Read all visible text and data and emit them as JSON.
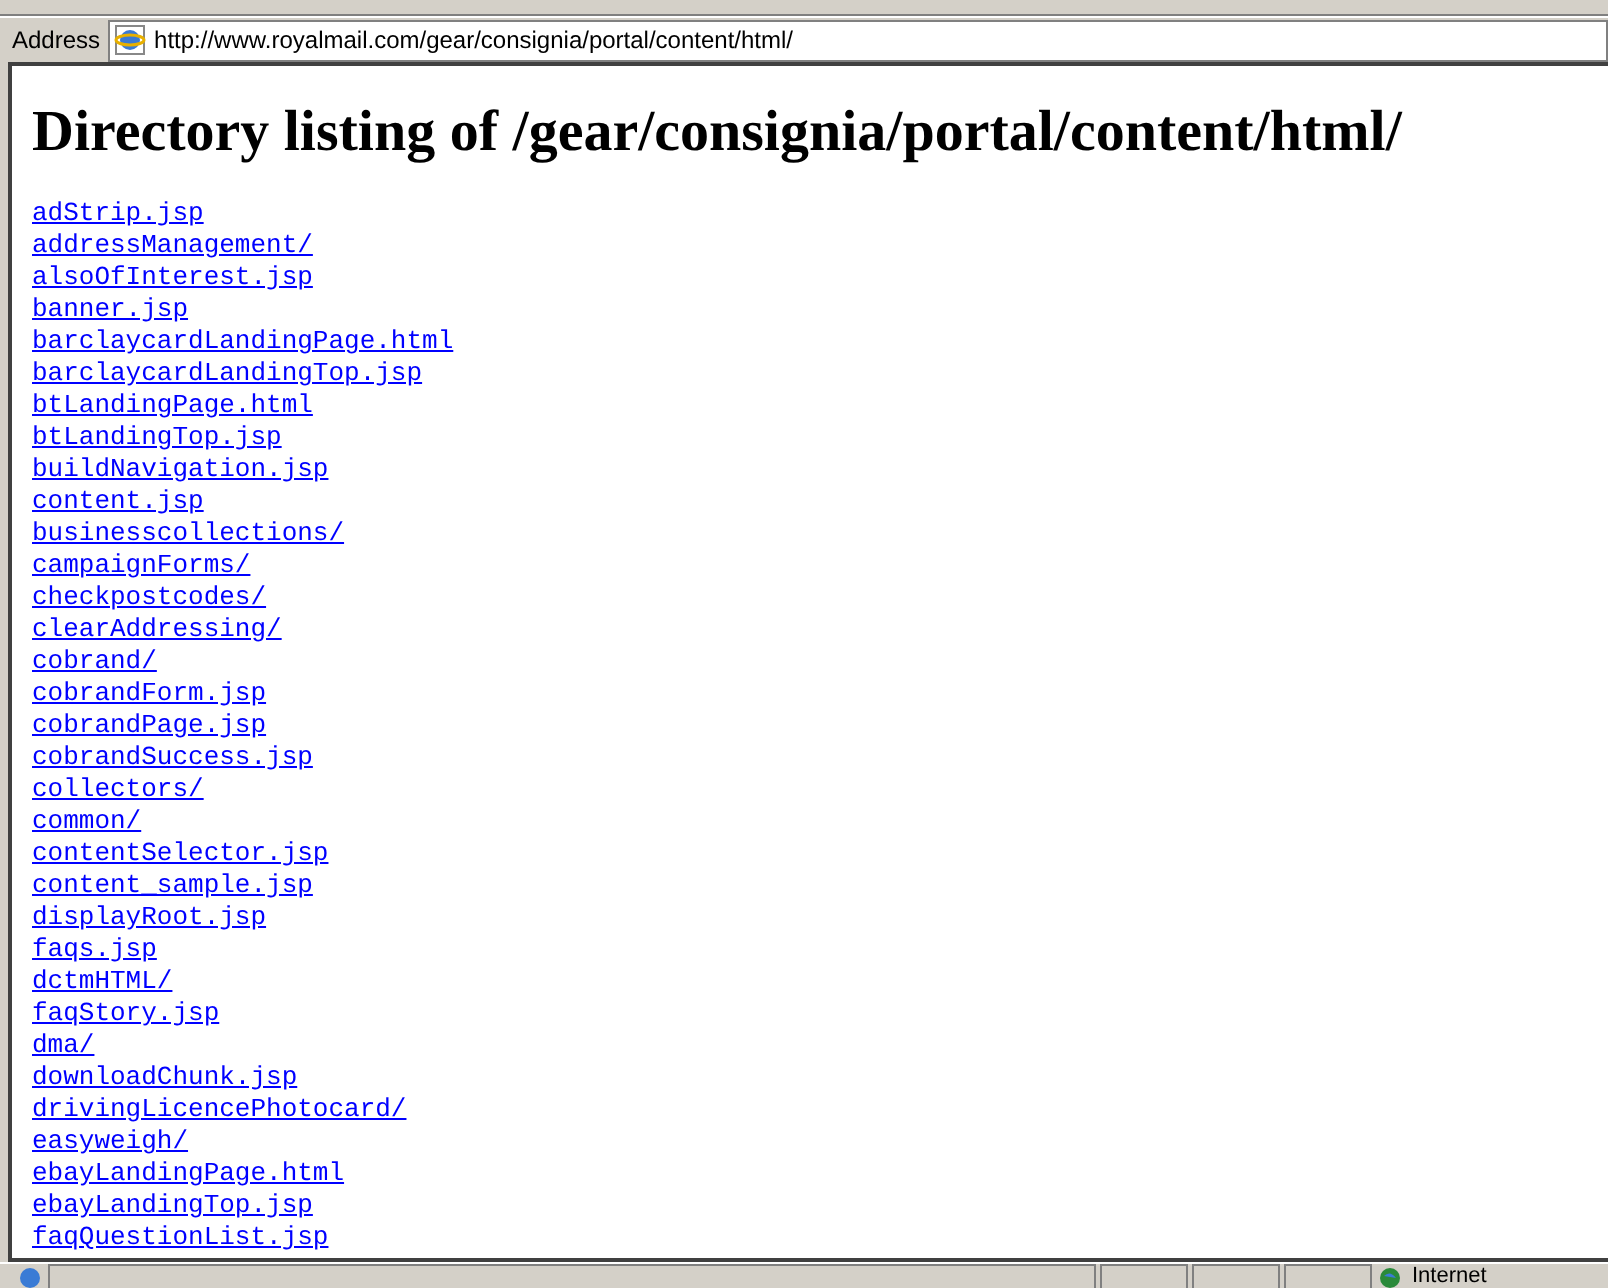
{
  "address_bar": {
    "label": "Address",
    "url": "http://www.royalmail.com/gear/consignia/portal/content/html/"
  },
  "page": {
    "heading": "Directory listing of /gear/consignia/portal/content/html/",
    "links": [
      "adStrip.jsp",
      "addressManagement/",
      "alsoOfInterest.jsp",
      "banner.jsp",
      "barclaycardLandingPage.html",
      "barclaycardLandingTop.jsp",
      "btLandingPage.html",
      "btLandingTop.jsp",
      "buildNavigation.jsp",
      "content.jsp",
      "businesscollections/",
      "campaignForms/",
      "checkpostcodes/",
      "clearAddressing/",
      "cobrand/",
      "cobrandForm.jsp",
      "cobrandPage.jsp",
      "cobrandSuccess.jsp",
      "collectors/",
      "common/",
      "contentSelector.jsp",
      "content_sample.jsp",
      "displayRoot.jsp",
      "faqs.jsp",
      "dctmHTML/",
      "faqStory.jsp",
      "dma/",
      "downloadChunk.jsp",
      "drivingLicencePhotocard/",
      "easyweigh/",
      "ebayLandingPage.html",
      "ebayLandingTop.jsp",
      "faqQuestionList.jsp"
    ]
  },
  "status_bar": {
    "zone": "Internet"
  }
}
